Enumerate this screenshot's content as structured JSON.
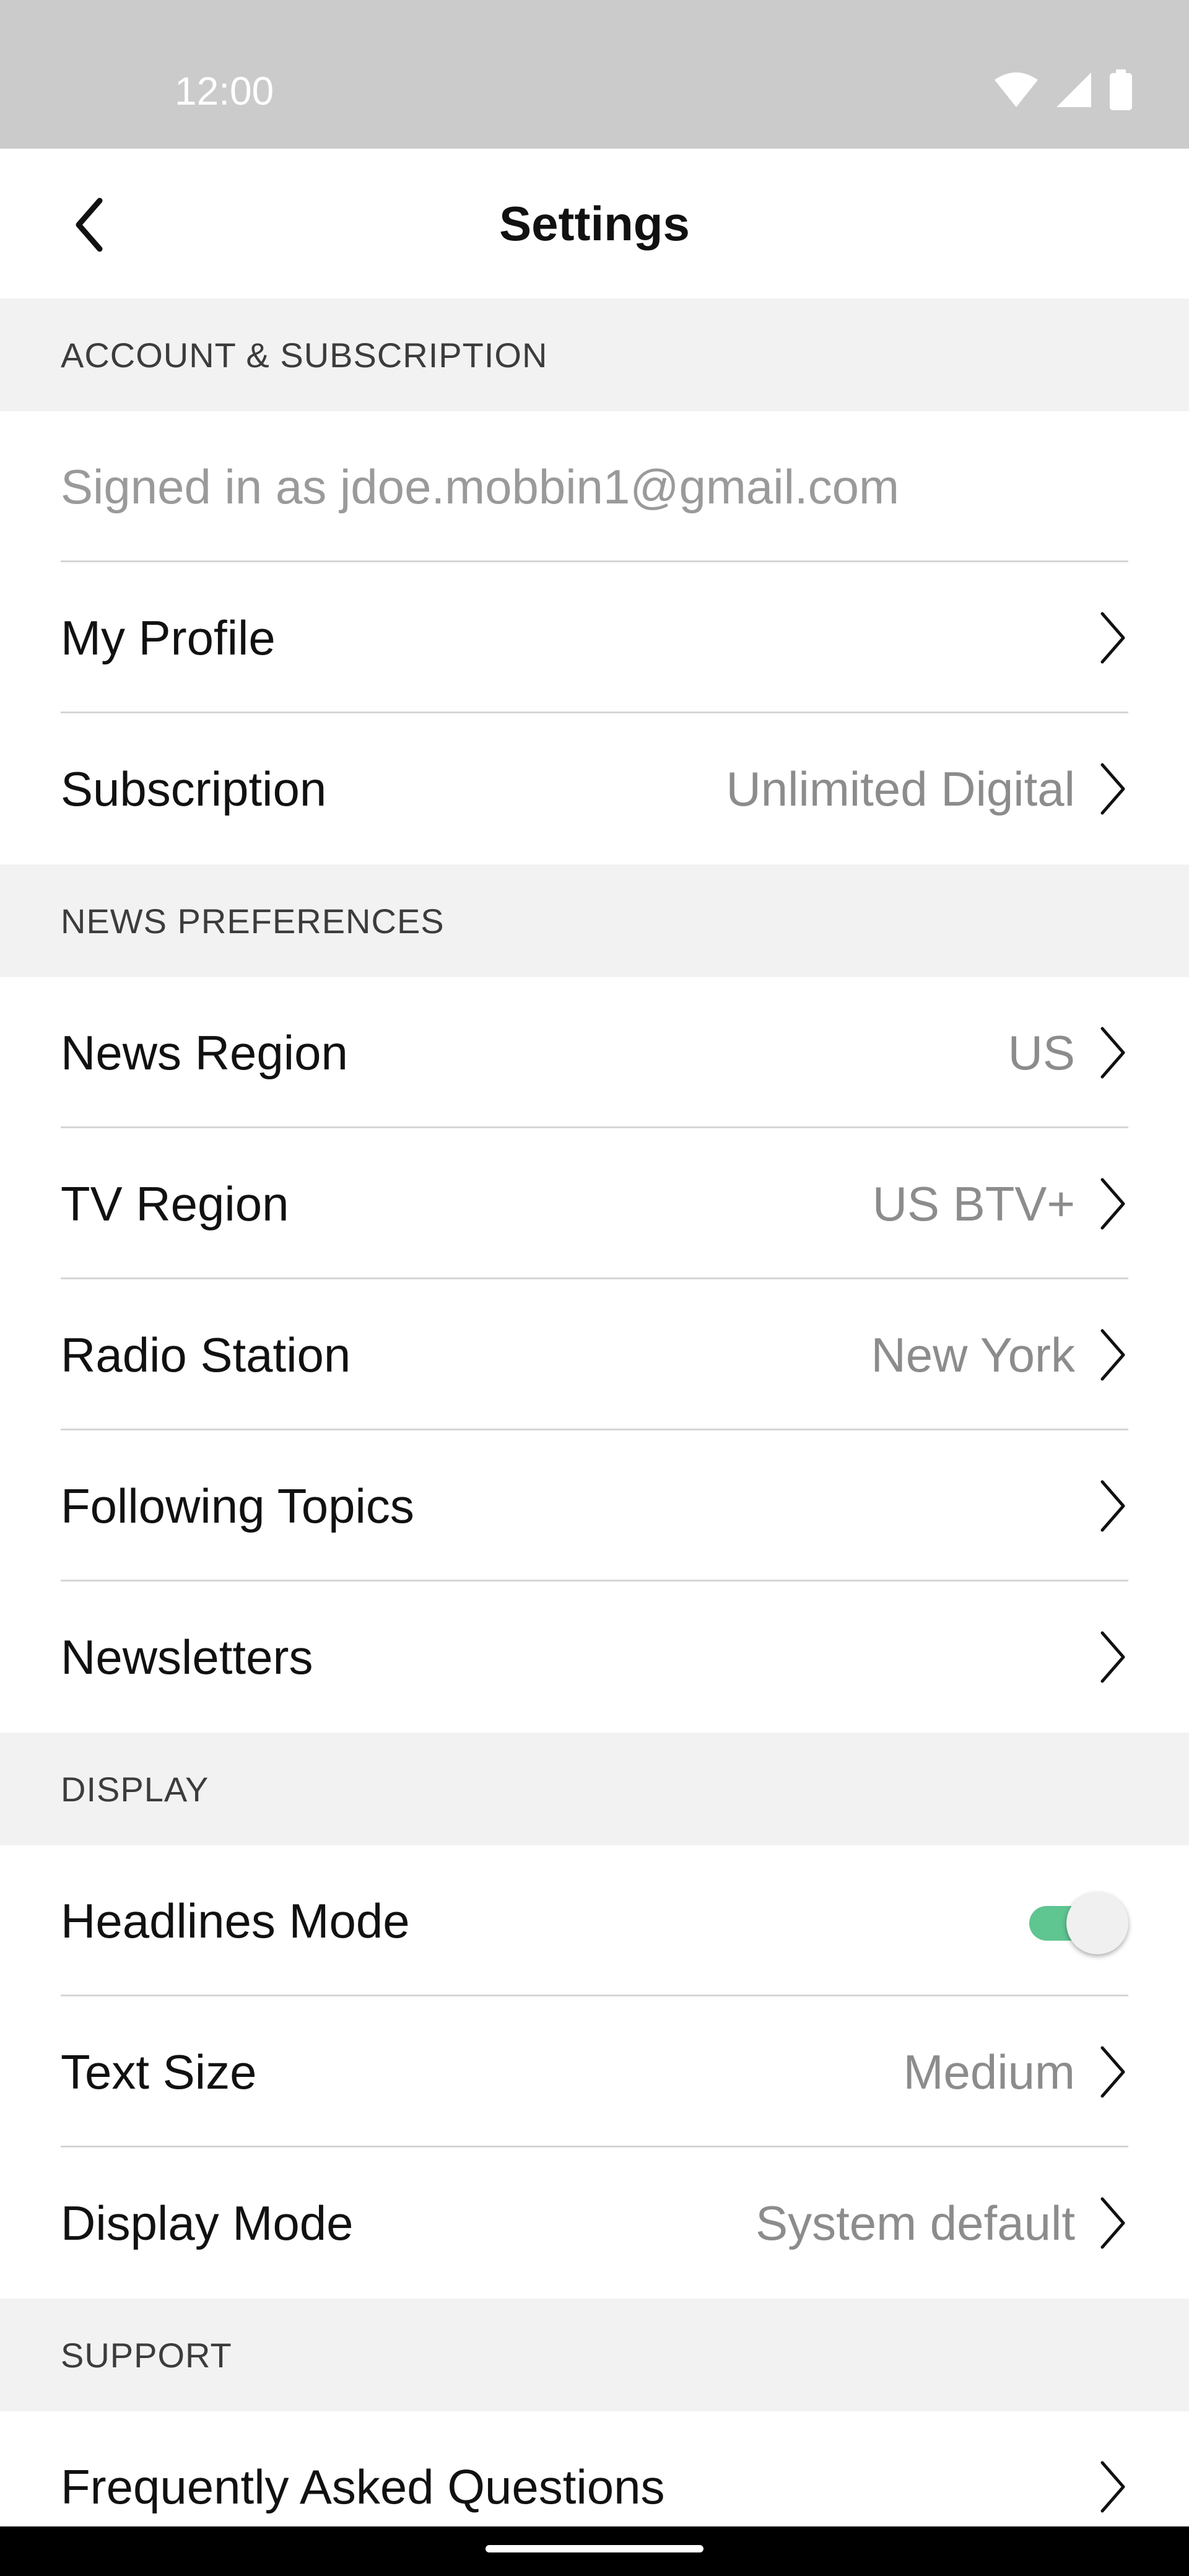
{
  "status_bar": {
    "time": "12:00",
    "icons": [
      "wifi-icon",
      "cell-signal-icon",
      "battery-icon"
    ]
  },
  "header": {
    "title": "Settings",
    "back_icon": "chevron-left-icon"
  },
  "sections": {
    "account": {
      "title": "ACCOUNT & SUBSCRIPTION",
      "signed_in": "Signed in as jdoe.mobbin1@gmail.com",
      "my_profile": "My Profile",
      "subscription": {
        "label": "Subscription",
        "value": "Unlimited Digital"
      }
    },
    "news": {
      "title": "NEWS PREFERENCES",
      "news_region": {
        "label": "News Region",
        "value": "US"
      },
      "tv_region": {
        "label": "TV Region",
        "value": "US BTV+"
      },
      "radio_station": {
        "label": "Radio Station",
        "value": "New York"
      },
      "following_topics": "Following Topics",
      "newsletters": "Newsletters"
    },
    "display": {
      "title": "DISPLAY",
      "headlines_mode": {
        "label": "Headlines Mode",
        "enabled": true
      },
      "text_size": {
        "label": "Text Size",
        "value": "Medium"
      },
      "display_mode": {
        "label": "Display Mode",
        "value": "System default"
      }
    },
    "support": {
      "title": "SUPPORT",
      "faq": "Frequently Asked Questions"
    }
  },
  "colors": {
    "toggle_on": "#5fc591",
    "section_bg": "#f2f2f2",
    "status_bar": "#cbcbcb"
  }
}
